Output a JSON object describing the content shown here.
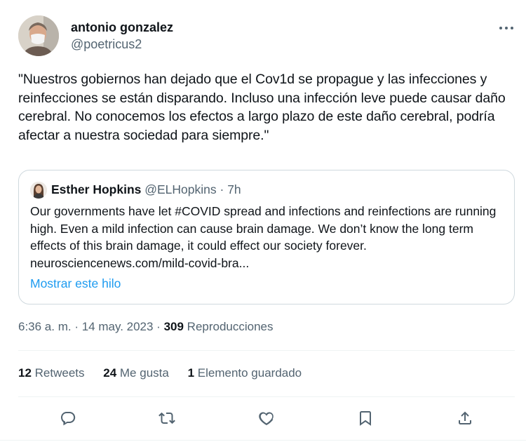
{
  "author": {
    "name": "antonio gonzalez",
    "handle": "@poetricus2"
  },
  "tweet": {
    "text": "\"Nuestros gobiernos han dejado que el Cov1d se propague y las infecciones y reinfecciones se están disparando. Incluso una infección leve puede causar daño cerebral. No conocemos los efectos a largo plazo de este daño cerebral, podría afectar a nuestra sociedad para siempre.\""
  },
  "quote": {
    "name": "Esther Hopkins",
    "meta": "@ELHopkins · 7h",
    "text": "Our governments have let #COVID spread and infections and reinfections are running high. Even a mild infection can cause brain damage. We don’t know the long term effects of this brain damage, it could effect our society forever. neurosciencenews.com/mild-covid-bra...",
    "show_thread": "Mostrar este hilo"
  },
  "meta": {
    "time": "6:36 a. m. · 14 may. 2023 · ",
    "views_count": "309",
    "views_label": " Reproducciones"
  },
  "stats": {
    "retweets_count": "12",
    "retweets_label": " Retweets",
    "likes_count": "24",
    "likes_label": " Me gusta",
    "bookmarks_count": "1",
    "bookmarks_label": " Elemento guardado"
  },
  "icons": {
    "more": "more-icon",
    "reply": "reply-icon",
    "retweet": "retweet-icon",
    "like": "like-icon",
    "bookmark": "bookmark-icon",
    "share": "share-icon"
  },
  "colors": {
    "text_primary": "#0f1419",
    "text_secondary": "#536471",
    "link": "#1d9bf0",
    "border": "#cfd9de",
    "divider": "#eff3f4"
  }
}
